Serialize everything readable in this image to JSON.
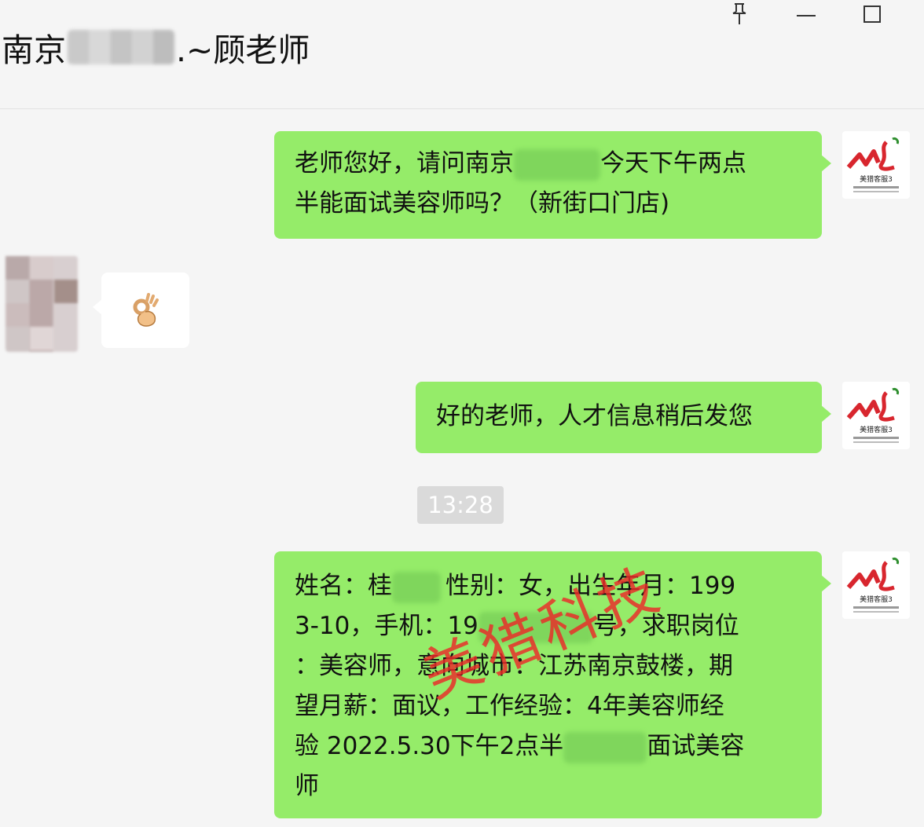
{
  "window": {
    "title_prefix": "南京",
    "title_suffix": ".~顾老师",
    "controls": {
      "pin_glyph": "⚲",
      "minimize_label": "",
      "maximize_label": ""
    }
  },
  "messages": [
    {
      "sender": "me",
      "line1_before": "老师您好，请问南京",
      "line1_after": "今天下午两点",
      "line2": "半能面试美容师吗？（新街口门店)"
    },
    {
      "sender": "other",
      "emoji": "👌"
    },
    {
      "sender": "me",
      "text": "好的老师，人才信息稍后发您"
    },
    {
      "type": "timestamp",
      "text": "13:28"
    },
    {
      "sender": "me",
      "lines": [
        {
          "a": "姓名：桂",
          "b": "性别：女，出生年月：199"
        },
        {
          "a": "3-10，手机：19",
          "b": "号，求职岗位"
        },
        {
          "a": "：美容师，意向城市：江苏南京鼓楼，期"
        },
        {
          "a": "望月薪：面议，工作经验：4年美容师经"
        },
        {
          "a": "验 2022.5.30下午2点半",
          "b": "面试美容"
        },
        {
          "a": "师"
        }
      ]
    }
  ],
  "watermark": {
    "text": "美猎科技"
  },
  "brand_avatar": {
    "text": "美猎客服3",
    "color": "#d8262e"
  }
}
